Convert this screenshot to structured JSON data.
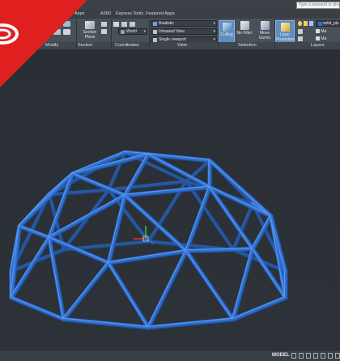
{
  "search": {
    "placeholder": "Type a keyword or phrase"
  },
  "tabs": [
    {
      "label": "Apps"
    },
    {
      "label": "A360"
    },
    {
      "label": "Express Tools"
    },
    {
      "label": "Featured Apps"
    }
  ],
  "ribbon": {
    "modify": {
      "label": "Modify"
    },
    "section": {
      "plane_label": "Section Plane",
      "panel_label": "Section"
    },
    "coordinates": {
      "ucs_value": "World",
      "panel_label": "Coordinates"
    },
    "view": {
      "visual_style": "Realistic",
      "named_view": "Unsaved View",
      "viewport_config": "Single viewport",
      "panel_label": "View"
    },
    "selection": {
      "culling_label": "Culling",
      "no_filter_label": "No Filter",
      "move_gizmo_label": "Move Gizmo",
      "panel_label": "Selection"
    },
    "layers": {
      "properties_label": "Layer Properties",
      "current_layer": "solid_plus",
      "match_label": "Ma",
      "make_current_label": "Ma",
      "panel_label": "Layers"
    }
  },
  "dome": {
    "color": "#2f6fd0",
    "highlight": "#5d97ea",
    "shadow": "#1d4f9d"
  },
  "status": {
    "model_label": "MODEL"
  },
  "colors": {
    "banner": "#e0201f",
    "viewport": "#2b3036",
    "selected_button": "#7fa9d8"
  }
}
